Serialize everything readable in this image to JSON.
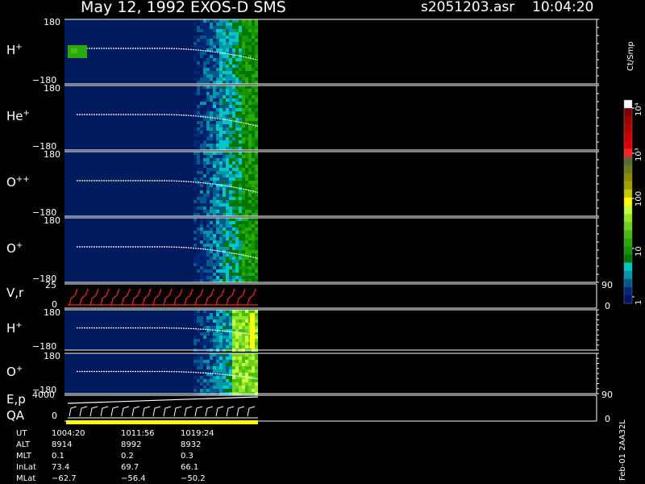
{
  "header": {
    "title": "May 12, 1992   EXOS-D SMS",
    "file": "s2051203.asr",
    "time": "10:04:20"
  },
  "colorbar": {
    "label": "Ct/Smp",
    "ticks": [
      "10⁴",
      "10³",
      "100",
      "10",
      "1"
    ],
    "colors": [
      "#ffffff",
      "#800000",
      "#a00000",
      "#b40000",
      "#cc0000",
      "#e00000",
      "#ff2020",
      "#556b2f",
      "#6b7a1a",
      "#8a8a00",
      "#a0a000",
      "#c8c800",
      "#ffff00",
      "#c8ff3c",
      "#96e628",
      "#6ed21e",
      "#46be14",
      "#28aa0a",
      "#149600",
      "#007800",
      "#00c8c8",
      "#0096aa",
      "#005a8c",
      "#002878",
      "#001466"
    ]
  },
  "panels": [
    {
      "id": "h-plus",
      "label": "H",
      "sup": "+",
      "top": "180",
      "bottom": "−180"
    },
    {
      "id": "he-plus",
      "label": "He",
      "sup": "+",
      "top": "180",
      "bottom": "−180"
    },
    {
      "id": "o-plus-plus",
      "label": "O",
      "sup": "++",
      "top": "180",
      "bottom": "−180"
    },
    {
      "id": "o-plus",
      "label": "O",
      "sup": "+",
      "top": "180",
      "bottom": "−180"
    }
  ],
  "panels_lower": [
    {
      "id": "h-plus-2",
      "label": "H",
      "sup": "+",
      "top": "180",
      "bottom": "−180"
    },
    {
      "id": "o-plus-2",
      "label": "O",
      "sup": "+",
      "top": "180",
      "bottom": "−180"
    }
  ],
  "line_panels": {
    "vr": {
      "label": "V,r",
      "ytop": "25",
      "ybot": "0",
      "rtop": "90",
      "rbot": "0"
    },
    "ep": {
      "label": "E,p",
      "label2": "QA",
      "ytop": "4000",
      "ybot": "0",
      "rtop": "90",
      "rbot": "0"
    }
  },
  "side_label": "Feb-01 2AA32L",
  "footer": {
    "rows": [
      {
        "label": "UT",
        "values": [
          "1004:20",
          "1011:56",
          "1019:24"
        ]
      },
      {
        "label": "ALT",
        "values": [
          "8914",
          "8992",
          "8932"
        ]
      },
      {
        "label": "MLT",
        "values": [
          "0.1",
          "0.2",
          "0.3"
        ]
      },
      {
        "label": "InLat",
        "values": [
          "73.4",
          "69.7",
          "66.1"
        ]
      },
      {
        "label": "MLat",
        "values": [
          "−62.7",
          "−56.4",
          "−50.2"
        ]
      }
    ]
  },
  "chart_data": {
    "type": "heatmap",
    "title": "May 12, 1992   EXOS-D SMS",
    "panels": [
      "H+",
      "He+",
      "O++",
      "O+",
      "V,r",
      "H+",
      "O+",
      "E,p / QA"
    ],
    "y_range_spectrogram": [
      -180,
      180
    ],
    "y_range_vr": [
      0,
      25
    ],
    "y_range_ep": [
      0,
      4000
    ],
    "colorbar_range": [
      1,
      10000
    ],
    "colorbar_scale": "log",
    "x_ut_labels": [
      "1004:20",
      "1011:56",
      "1019:24"
    ]
  }
}
